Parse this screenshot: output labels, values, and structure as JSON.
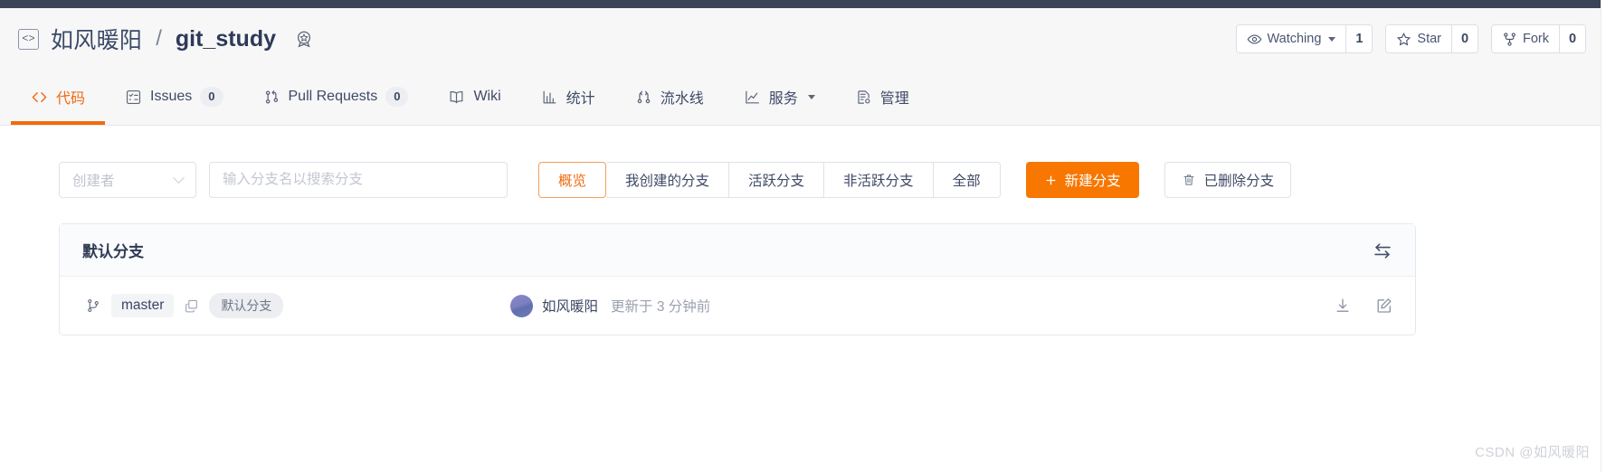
{
  "header": {
    "repo_icon": "code-brackets-icon",
    "owner": "如风暖阳",
    "separator": "/",
    "repo_name": "git_study",
    "badge_icon": "award-badge-icon",
    "actions": {
      "watch": {
        "icon": "eye-icon",
        "label": "Watching",
        "count": "1"
      },
      "star": {
        "icon": "star-icon",
        "label": "Star",
        "count": "0"
      },
      "fork": {
        "icon": "fork-icon",
        "label": "Fork",
        "count": "0"
      }
    }
  },
  "nav_tabs": [
    {
      "label": "代码",
      "icon": "code-icon",
      "active": true,
      "count": null,
      "caret": false
    },
    {
      "label": "Issues",
      "icon": "issues-list-icon",
      "active": false,
      "count": "0",
      "caret": false
    },
    {
      "label": "Pull Requests",
      "icon": "pull-request-icon",
      "active": false,
      "count": "0",
      "caret": false
    },
    {
      "label": "Wiki",
      "icon": "book-icon",
      "active": false,
      "count": null,
      "caret": false
    },
    {
      "label": "统计",
      "icon": "bar-chart-icon",
      "active": false,
      "count": null,
      "caret": false
    },
    {
      "label": "流水线",
      "icon": "pipeline-icon",
      "active": false,
      "count": null,
      "caret": false
    },
    {
      "label": "服务",
      "icon": "line-chart-icon",
      "active": false,
      "count": null,
      "caret": true
    },
    {
      "label": "管理",
      "icon": "document-gear-icon",
      "active": false,
      "count": null,
      "caret": false
    }
  ],
  "filter_bar": {
    "creator_select": {
      "placeholder": "创建者",
      "icon": "chevron-down-icon"
    },
    "search": {
      "placeholder": "输入分支名以搜索分支",
      "value": ""
    },
    "segments": [
      {
        "label": "概览",
        "active": true
      },
      {
        "label": "我创建的分支",
        "active": false
      },
      {
        "label": "活跃分支",
        "active": false
      },
      {
        "label": "非活跃分支",
        "active": false
      },
      {
        "label": "全部",
        "active": false
      }
    ],
    "new_branch_button": {
      "label": "新建分支",
      "icon": "plus-icon"
    },
    "deleted_branch_button": {
      "label": "已删除分支",
      "icon": "trash-icon"
    }
  },
  "branch_card": {
    "title": "默认分支",
    "compare_icon": "compare-arrows-icon",
    "rows": [
      {
        "branch_icon": "branch-icon",
        "name": "master",
        "copy_icon": "copy-icon",
        "tag": "默认分支",
        "author": "如风暖阳",
        "updated": "更新于 3 分钟前",
        "download_icon": "download-icon",
        "edit_icon": "edit-icon"
      }
    ]
  },
  "watermark": "CSDN @如风暖阳",
  "colors": {
    "accent_orange": "#f26a0e",
    "primary_button": "#f77700",
    "top_strip": "#3b4457",
    "header_bg": "#f7f7f8",
    "text_dark": "#3b4a68"
  }
}
